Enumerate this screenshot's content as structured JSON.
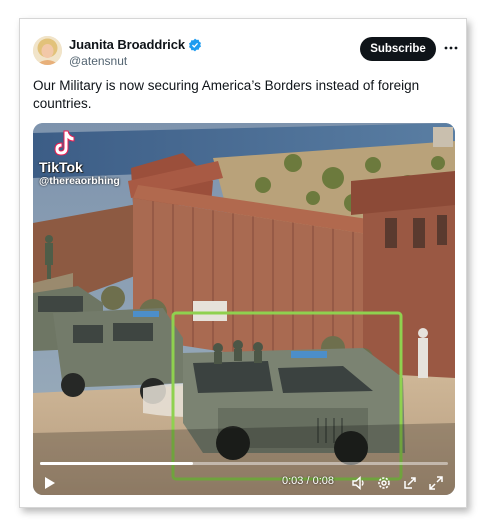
{
  "post": {
    "author": {
      "name": "Juanita Broaddrick",
      "handle": "@atensnut",
      "verified": true
    },
    "subscribe_label": "Subscribe",
    "more_icon": "ellipsis-icon",
    "text": "Our Military is now securing America’s Borders instead of foreign countries."
  },
  "video": {
    "watermark_brand": "TikTok",
    "watermark_handle": "@thereaorbhing",
    "time_display": "0:03 / 0:08",
    "progress": 0.375,
    "controls": [
      "play-icon",
      "volume-icon",
      "settings-icon",
      "popout-icon",
      "fullscreen-icon"
    ],
    "highlight_color": "#8fd14f"
  },
  "colors": {
    "verified": "#1d9bf0",
    "button": "#0f1419",
    "handle": "#536471"
  }
}
